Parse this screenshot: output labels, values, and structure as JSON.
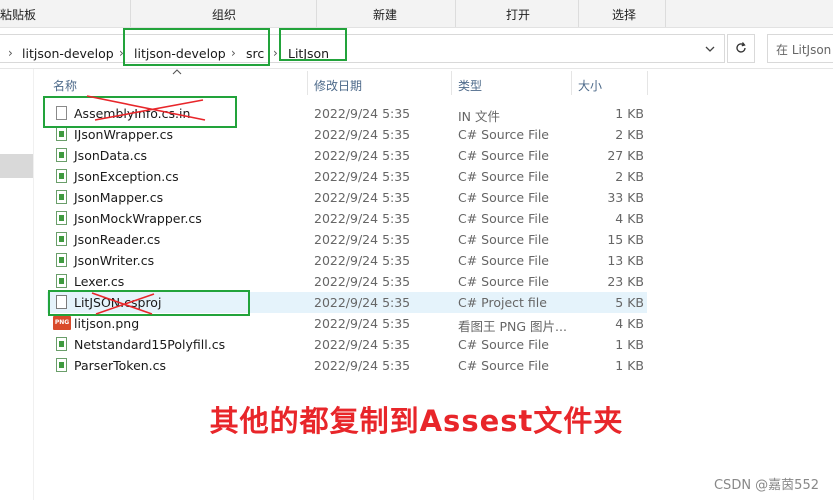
{
  "ribbon": {
    "clipboard_label": "粘贴板",
    "organize_label": "组织",
    "new_label": "新建",
    "open_label": "打开",
    "select_label": "选择"
  },
  "address": {
    "root_arrow": "›",
    "crumbs": [
      "litjson-develop",
      "litjson-develop",
      "src",
      "LitJson"
    ],
    "separator": "›",
    "dropdown_icon": "chevron-down-icon",
    "refresh_icon": "refresh-icon"
  },
  "search": {
    "placeholder": "在 LitJson"
  },
  "columns": {
    "name": "名称",
    "date": "修改日期",
    "type": "类型",
    "size": "大小"
  },
  "files": [
    {
      "name": "AssemblyInfo.cs.in",
      "date": "2022/9/24 5:35",
      "type": "IN 文件",
      "size": "1 KB",
      "icon": "document-icon",
      "highlighted": true,
      "struck": true
    },
    {
      "name": "IJsonWrapper.cs",
      "date": "2022/9/24 5:35",
      "type": "C# Source File",
      "size": "2 KB",
      "icon": "csharp-file-icon"
    },
    {
      "name": "JsonData.cs",
      "date": "2022/9/24 5:35",
      "type": "C# Source File",
      "size": "27 KB",
      "icon": "csharp-file-icon"
    },
    {
      "name": "JsonException.cs",
      "date": "2022/9/24 5:35",
      "type": "C# Source File",
      "size": "2 KB",
      "icon": "csharp-file-icon"
    },
    {
      "name": "JsonMapper.cs",
      "date": "2022/9/24 5:35",
      "type": "C# Source File",
      "size": "33 KB",
      "icon": "csharp-file-icon"
    },
    {
      "name": "JsonMockWrapper.cs",
      "date": "2022/9/24 5:35",
      "type": "C# Source File",
      "size": "4 KB",
      "icon": "csharp-file-icon"
    },
    {
      "name": "JsonReader.cs",
      "date": "2022/9/24 5:35",
      "type": "C# Source File",
      "size": "15 KB",
      "icon": "csharp-file-icon"
    },
    {
      "name": "JsonWriter.cs",
      "date": "2022/9/24 5:35",
      "type": "C# Source File",
      "size": "13 KB",
      "icon": "csharp-file-icon"
    },
    {
      "name": "Lexer.cs",
      "date": "2022/9/24 5:35",
      "type": "C# Source File",
      "size": "23 KB",
      "icon": "csharp-file-icon"
    },
    {
      "name": "LitJSON.csproj",
      "date": "2022/9/24 5:35",
      "type": "C# Project file",
      "size": "5 KB",
      "icon": "project-file-icon",
      "selected": true,
      "highlighted": true,
      "struck": true
    },
    {
      "name": "litjson.png",
      "date": "2022/9/24 5:35",
      "type": "看图王 PNG 图片...",
      "size": "4 KB",
      "icon": "png-image-icon"
    },
    {
      "name": "Netstandard15Polyfill.cs",
      "date": "2022/9/24 5:35",
      "type": "C# Source File",
      "size": "1 KB",
      "icon": "csharp-file-icon"
    },
    {
      "name": "ParserToken.cs",
      "date": "2022/9/24 5:35",
      "type": "C# Source File",
      "size": "1 KB",
      "icon": "csharp-file-icon"
    }
  ],
  "annotation": {
    "caption": "其他的都复制到Assest文件夹",
    "color": "#e8262a",
    "box_color": "#22a33b"
  },
  "watermark": "CSDN @嘉茵552"
}
